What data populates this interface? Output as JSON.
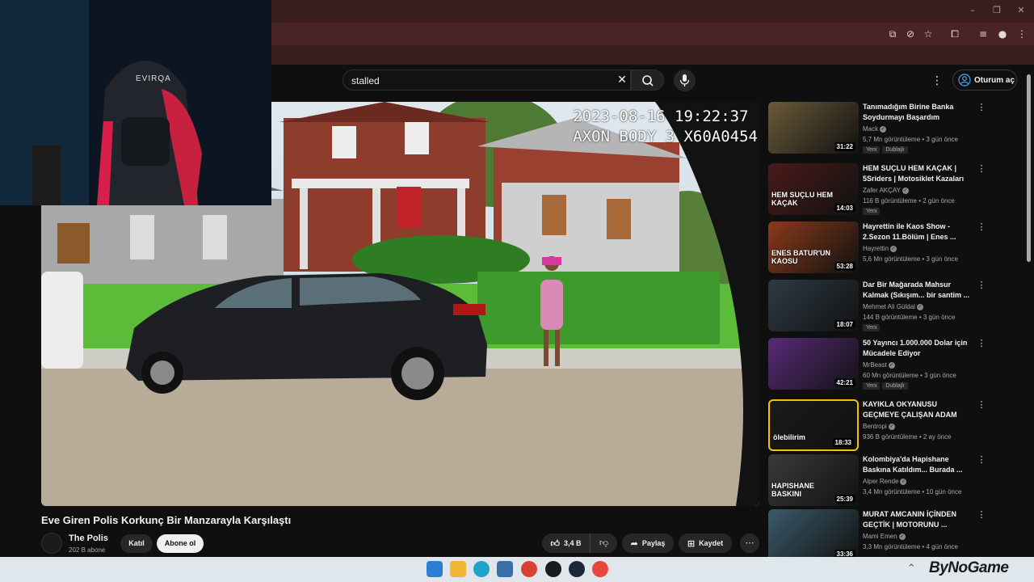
{
  "masthead": {
    "search_value": "stalled",
    "signin_label": "Oturum aç"
  },
  "video": {
    "stamp_line1": "2023-08-16 19:22:37",
    "stamp_line2": "AXON BODY 3 X60A0454",
    "title": "Eve Giren Polis Korkunç Bir Manzarayla Karşılaştı",
    "channel_name": "The Polis",
    "subscribers": "202 B abone",
    "join_label": "Katıl",
    "subscribe_label": "Abone ol",
    "likes": "3,4 B",
    "share_label": "Paylaş",
    "save_label": "Kaydet"
  },
  "webcam": {
    "chair_brand": "EVIRQA"
  },
  "recommendations": [
    {
      "title": "Tanımadığım Birine Banka Soydurmayı Başardım",
      "channel": "Mack",
      "meta": "5,7 Mn görüntüleme • 3 gün önce",
      "badges": [
        "Yeni",
        "Dublajlı"
      ],
      "duration": "31:22",
      "thumb_color": "#6b5a3a"
    },
    {
      "title": "HEM SUÇLU HEM KAÇAK | 5Sriders | Motosiklet Kazaları ...",
      "channel": "Zafer AKÇAY",
      "meta": "116 B görüntüleme • 2 gün önce",
      "badges": [
        "Yeni"
      ],
      "duration": "14:03",
      "thumb_color": "#4a1a1a",
      "thumb_text": "HEM SUÇLU HEM KAÇAK"
    },
    {
      "title": "Hayrettin ile Kaos Show - 2.Sezon 11.Bölüm | Enes ...",
      "channel": "Hayrettin",
      "meta": "5,6 Mn görüntüleme • 3 gün önce",
      "badges": [],
      "duration": "53:28",
      "thumb_color": "#8a3a1a",
      "thumb_text": "ENES BATUR'UN KAOSU"
    },
    {
      "title": "Dar Bir Mağarada Mahsur Kalmak (Sıkışım... bir santim ...",
      "channel": "Mehmet Ali Güldal",
      "meta": "144 B görüntüleme • 3 gün önce",
      "badges": [
        "Yeni"
      ],
      "duration": "18:07",
      "thumb_color": "#2e3a44"
    },
    {
      "title": "50 Yayıncı 1.000.000 Dolar için Mücadele Ediyor",
      "channel": "MrBeast",
      "meta": "60 Mn görüntüleme • 3 gün önce",
      "badges": [
        "Yeni",
        "Dublajlı"
      ],
      "duration": "42:21",
      "thumb_color": "#5a2a7a"
    },
    {
      "title": "KAYIKLA OKYANUSU GEÇMEYE ÇALIŞAN ADAM",
      "channel": "Bentropi",
      "meta": "936 B görüntüleme • 2 ay önce",
      "badges": [],
      "duration": "18:33",
      "thumb_color": "#1a1a1a",
      "thumb_text": "ölebilirim"
    },
    {
      "title": "Kolombiya'da Hapishane Baskına Katıldım... Burada ...",
      "channel": "Alper Rende",
      "meta": "3,4 Mn görüntüleme • 10 gün önce",
      "badges": [],
      "duration": "25:39",
      "thumb_color": "#3a3a3a",
      "thumb_text": "HAPISHANE BASKINI"
    },
    {
      "title": "MURAT AMCANIN İÇİNDEN GEÇTİK | MOTORUNU ...",
      "channel": "Mami Emen",
      "meta": "3,3 Mn görüntüleme • 4 gün önce",
      "badges": [],
      "duration": "33:36",
      "thumb_color": "#3a5a6a"
    }
  ],
  "taskbar": {
    "brand": "ByNoGame"
  },
  "colors": {
    "yt_bg": "#0f0f0f",
    "chrome_frame": "#3a1e1e",
    "taskbar": "#dfe6ec"
  }
}
